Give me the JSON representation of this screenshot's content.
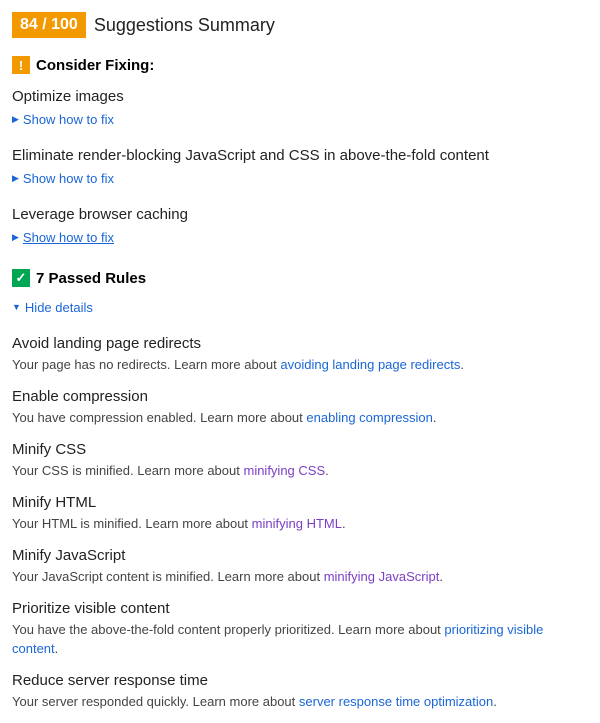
{
  "header": {
    "score": "84 / 100",
    "title": "Suggestions Summary"
  },
  "consider": {
    "badge": "!",
    "title": "Consider Fixing:",
    "rules": [
      {
        "title": "Optimize images",
        "toggle": "Show how to fix",
        "underlined": false
      },
      {
        "title": "Eliminate render-blocking JavaScript and CSS in above-the-fold content",
        "toggle": "Show how to fix",
        "underlined": false
      },
      {
        "title": "Leverage browser caching",
        "toggle": "Show how to fix",
        "underlined": true
      }
    ]
  },
  "passed": {
    "badge": "✓",
    "title": "7 Passed Rules",
    "toggle": "Hide details",
    "rules": [
      {
        "title": "Avoid landing page redirects",
        "pre": "Your page has no redirects. Learn more about ",
        "link": "avoiding landing page redirects",
        "linkClass": "link-blue",
        "post": "."
      },
      {
        "title": "Enable compression",
        "pre": "You have compression enabled. Learn more about ",
        "link": "enabling compression",
        "linkClass": "link-blue",
        "post": "."
      },
      {
        "title": "Minify CSS",
        "pre": "Your CSS is minified. Learn more about ",
        "link": "minifying CSS",
        "linkClass": "link-purple",
        "post": "."
      },
      {
        "title": "Minify HTML",
        "pre": "Your HTML is minified. Learn more about ",
        "link": "minifying HTML",
        "linkClass": "link-purple",
        "post": "."
      },
      {
        "title": "Minify JavaScript",
        "pre": "Your JavaScript content is minified. Learn more about ",
        "link": "minifying JavaScript",
        "linkClass": "link-purple",
        "post": "."
      },
      {
        "title": "Prioritize visible content",
        "pre": "You have the above-the-fold content properly prioritized. Learn more about ",
        "link": "prioritizing visible content",
        "linkClass": "link-blue",
        "post": "."
      },
      {
        "title": "Reduce server response time",
        "pre": "Your server responded quickly. Learn more about ",
        "link": "server response time optimization",
        "linkClass": "link-blue",
        "post": "."
      }
    ]
  }
}
